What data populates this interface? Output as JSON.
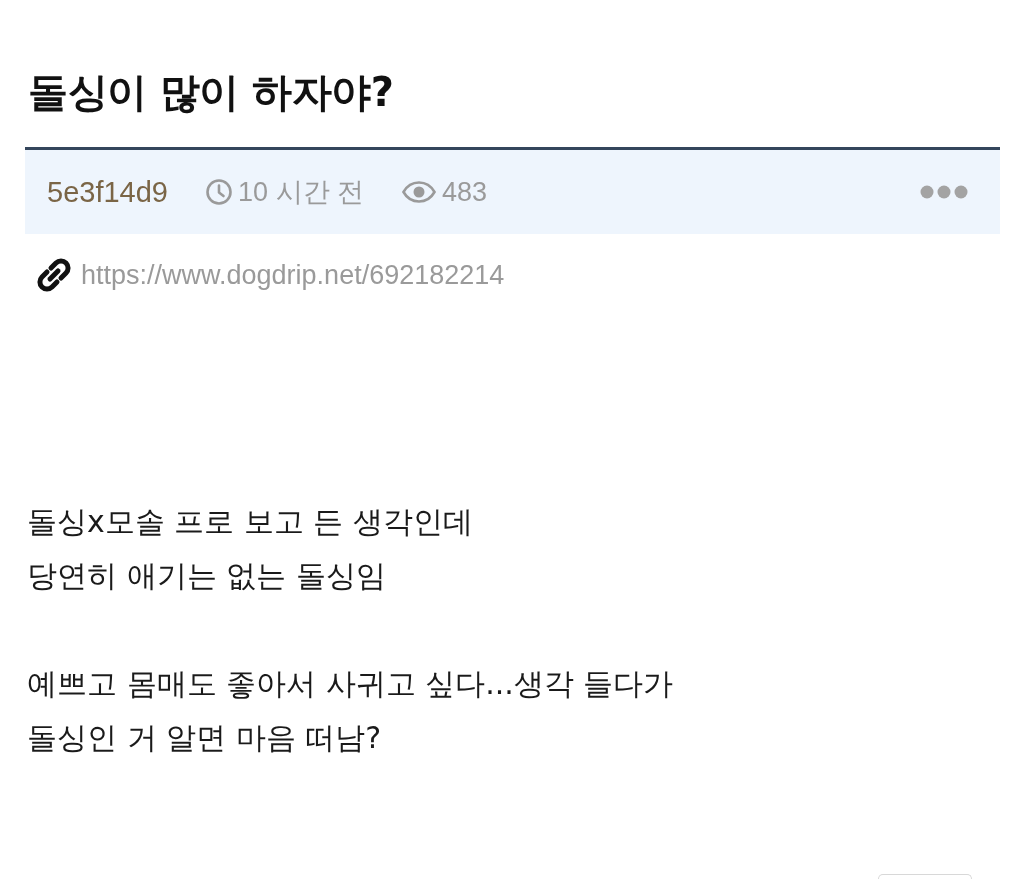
{
  "post": {
    "title": "돌싱이 많이 하자야?"
  },
  "meta": {
    "author": "5e3f14d9",
    "time": "10 시간 전",
    "views": "483"
  },
  "link": {
    "url": "https://www.dogdrip.net/692182214"
  },
  "body": {
    "paragraphs": [
      "돌싱x모솔 프로 보고 든 생각인데\n당연히 애기는 없는 돌싱임",
      "예쁘고 몸매도 좋아서 사귀고 싶다...생각 들다가\n돌싱인 거 알면 마음 떠남?"
    ]
  }
}
